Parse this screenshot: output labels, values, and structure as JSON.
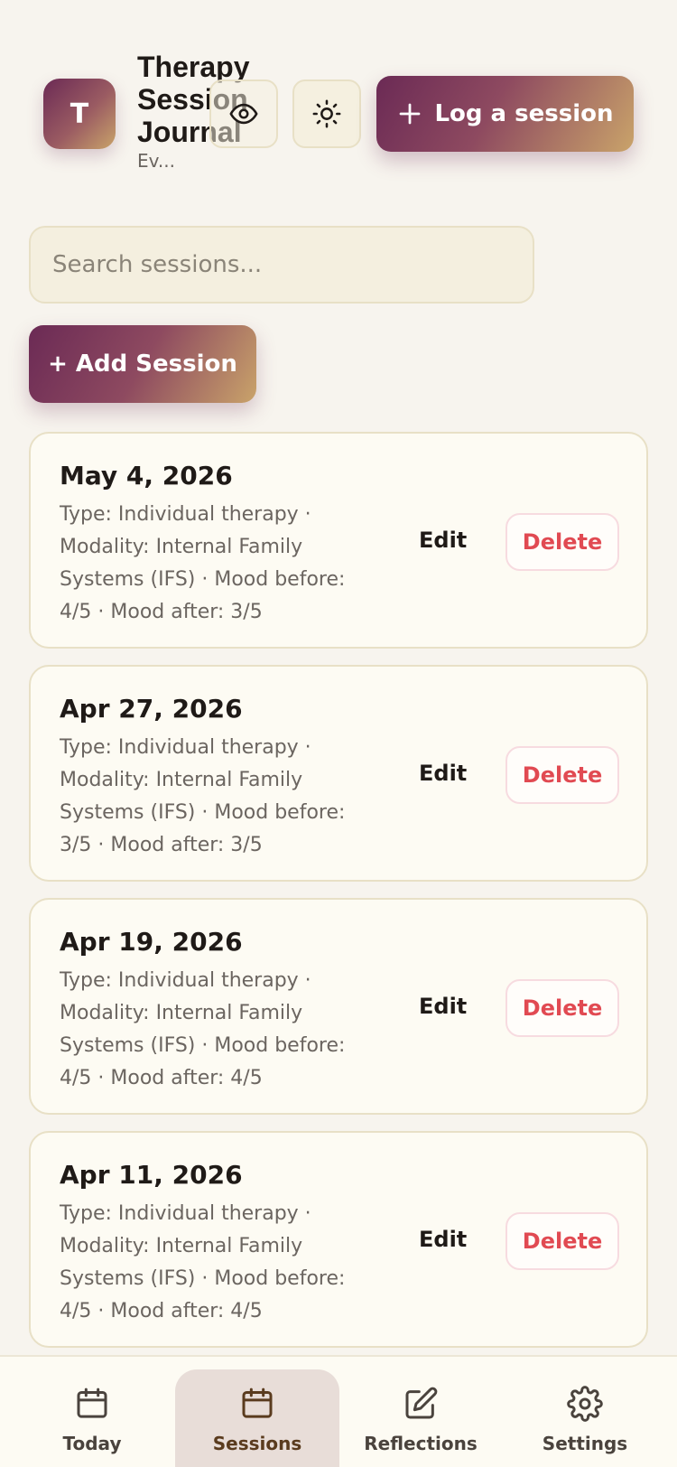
{
  "header": {
    "logo_letter": "T",
    "title": "Therapy Session Journal",
    "subtitle": "Ev...",
    "log_button_label": "Log a session",
    "visibility_icon": "eye-icon",
    "theme_icon": "sun-icon"
  },
  "search": {
    "placeholder": "Search sessions..."
  },
  "add_button_label": "+ Add Session",
  "sessions": [
    {
      "date": "May 4, 2026",
      "details": "Type: Individual therapy · Modality: Internal Family Systems (IFS) · Mood before: 4/5 · Mood after: 3/5",
      "edit_label": "Edit",
      "delete_label": "Delete"
    },
    {
      "date": "Apr 27, 2026",
      "details": "Type: Individual therapy · Modality: Internal Family Systems (IFS) · Mood before: 3/5 · Mood after: 3/5",
      "edit_label": "Edit",
      "delete_label": "Delete"
    },
    {
      "date": "Apr 19, 2026",
      "details": "Type: Individual therapy · Modality: Internal Family Systems (IFS) · Mood before: 4/5 · Mood after: 4/5",
      "edit_label": "Edit",
      "delete_label": "Delete"
    },
    {
      "date": "Apr 11, 2026",
      "details": "Type: Individual therapy · Modality: Internal Family Systems (IFS) · Mood before: 4/5 · Mood after: 4/5",
      "edit_label": "Edit",
      "delete_label": "Delete"
    }
  ],
  "nav": {
    "items": [
      {
        "label": "Today",
        "icon": "calendar-icon"
      },
      {
        "label": "Sessions",
        "icon": "calendar-icon",
        "active": true
      },
      {
        "label": "Reflections",
        "icon": "edit-icon"
      },
      {
        "label": "Settings",
        "icon": "gear-icon"
      }
    ]
  },
  "colors": {
    "accent_start": "#6b2a55",
    "accent_end": "#c9a36a",
    "danger": "#e14a52",
    "background": "#f7f4ee",
    "card": "#fdfbf3"
  }
}
